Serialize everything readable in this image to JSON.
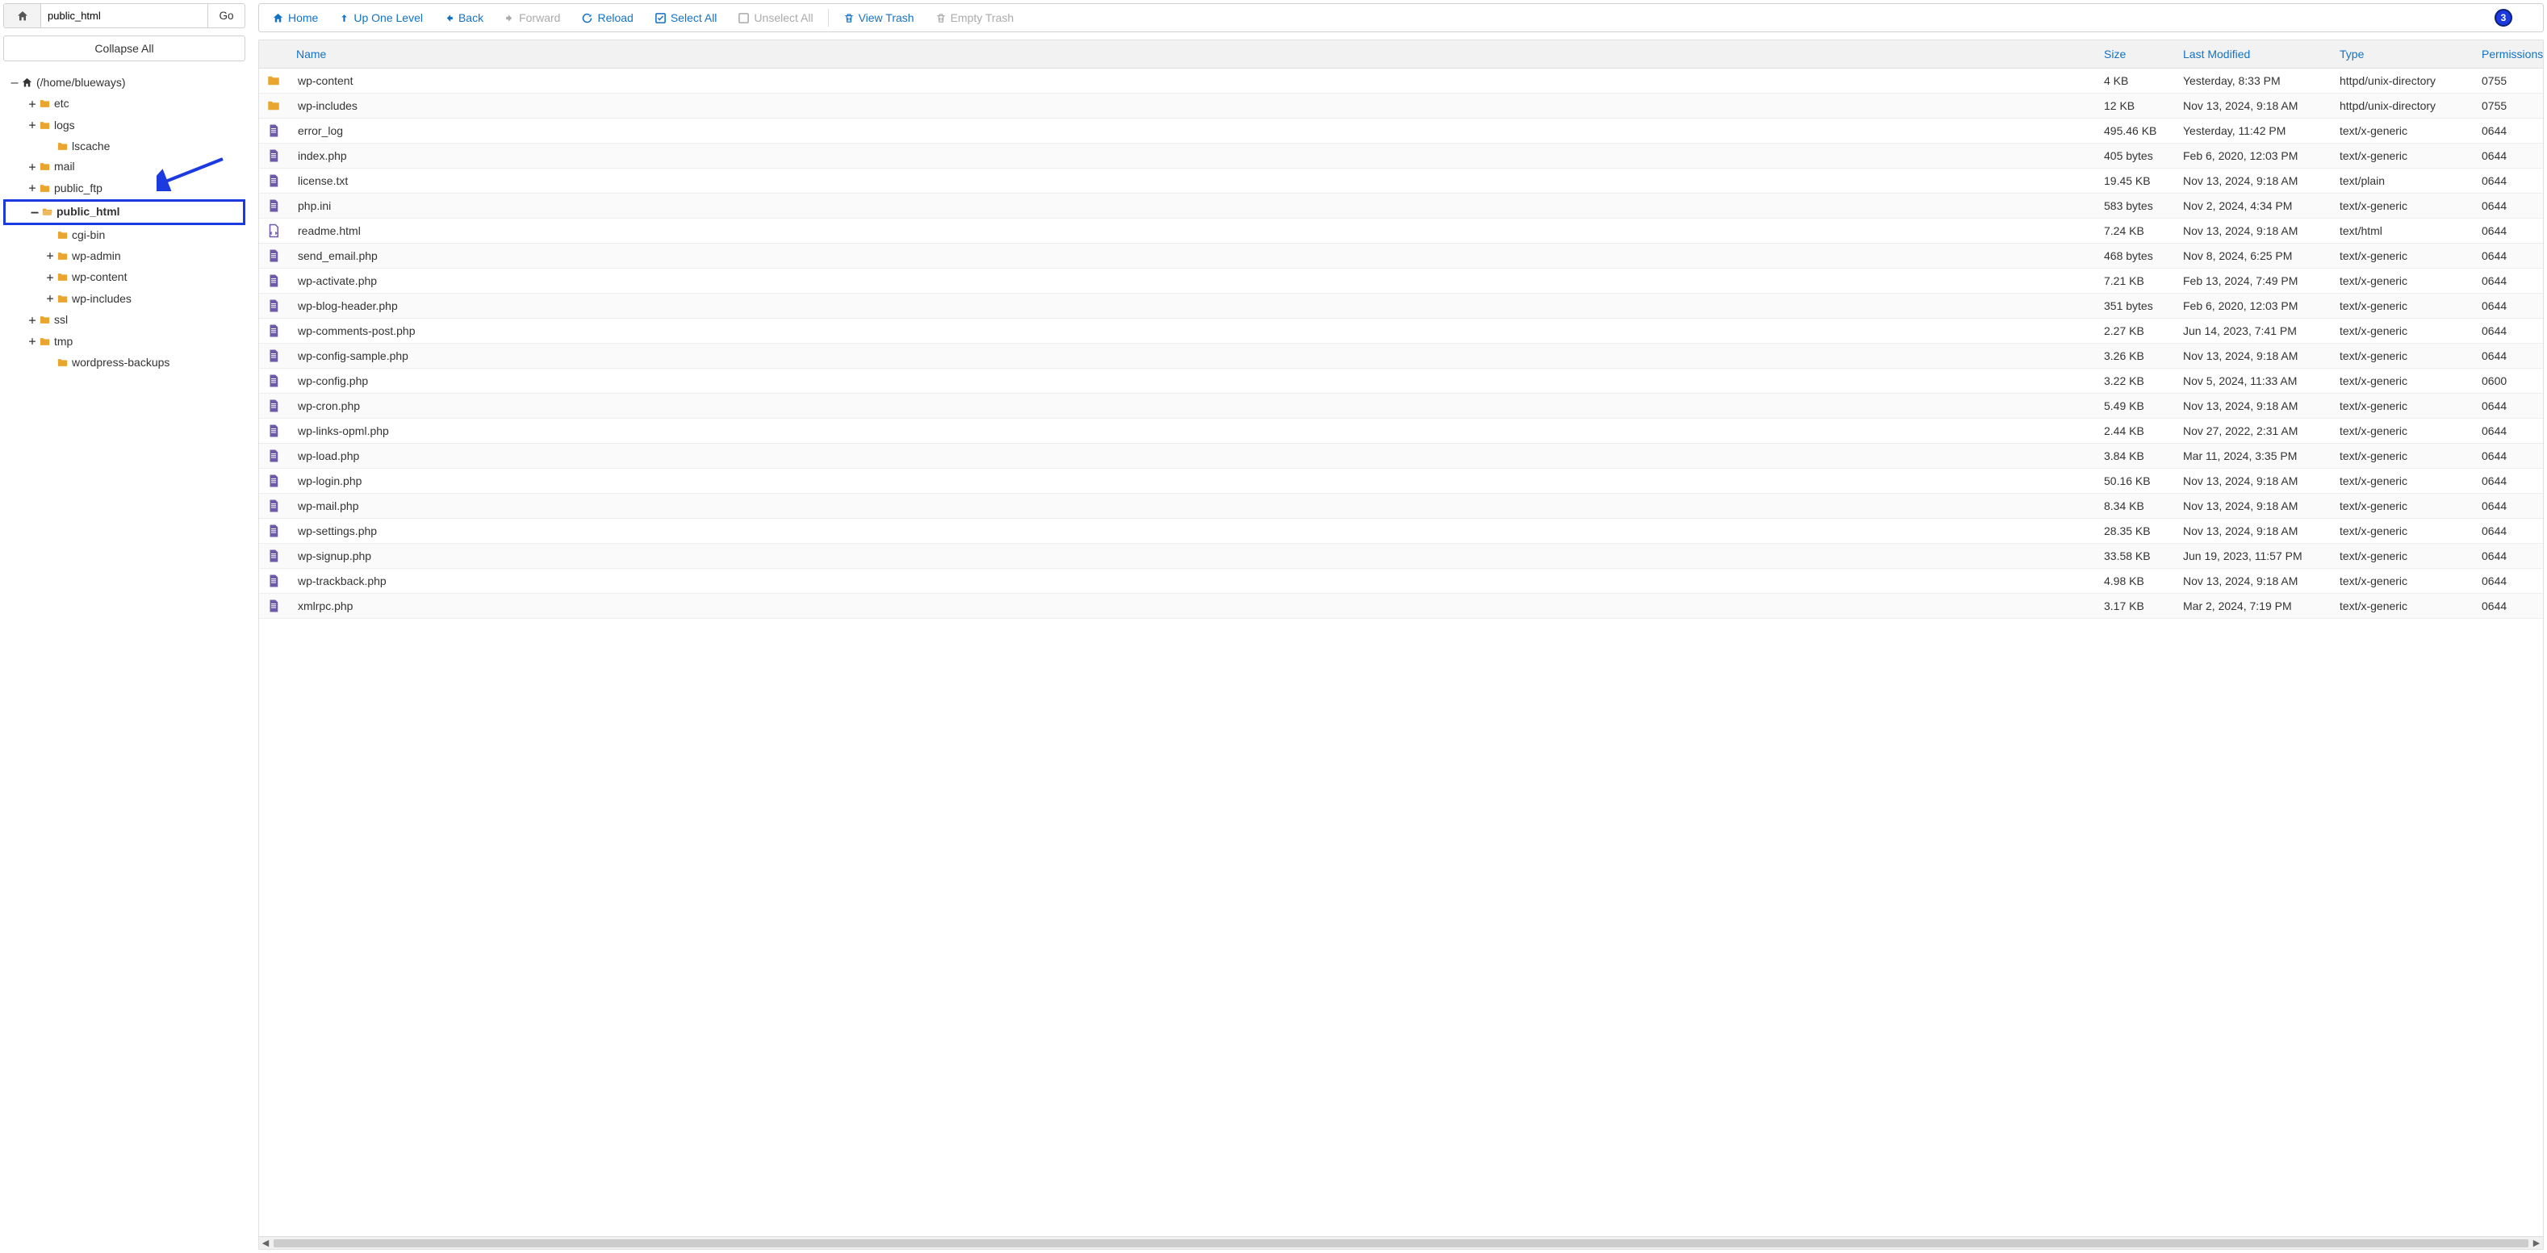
{
  "path_input": "public_html",
  "go_label": "Go",
  "collapse_label": "Collapse All",
  "badge": "3",
  "toolbar": [
    {
      "icon": "home",
      "label": "Home",
      "enabled": true
    },
    {
      "icon": "up",
      "label": "Up One Level",
      "enabled": true
    },
    {
      "icon": "back",
      "label": "Back",
      "enabled": true
    },
    {
      "icon": "forward",
      "label": "Forward",
      "enabled": false
    },
    {
      "icon": "reload",
      "label": "Reload",
      "enabled": true
    },
    {
      "icon": "select",
      "label": "Select All",
      "enabled": true
    },
    {
      "icon": "unselect",
      "label": "Unselect All",
      "enabled": false
    },
    {
      "divider": true
    },
    {
      "icon": "trash",
      "label": "View Trash",
      "enabled": true
    },
    {
      "icon": "trash",
      "label": "Empty Trash",
      "enabled": false
    }
  ],
  "columns": {
    "name": "Name",
    "size": "Size",
    "mod": "Last Modified",
    "type": "Type",
    "perm": "Permissions"
  },
  "tree": [
    {
      "depth": 0,
      "toggle": "–",
      "icon": "folder-open-home",
      "label": "(/home/blueways)"
    },
    {
      "depth": 1,
      "toggle": "+",
      "icon": "folder-closed",
      "label": "etc"
    },
    {
      "depth": 1,
      "toggle": "+",
      "icon": "folder-closed",
      "label": "logs"
    },
    {
      "depth": 2,
      "toggle": "",
      "icon": "folder-closed",
      "label": "lscache"
    },
    {
      "depth": 1,
      "toggle": "+",
      "icon": "folder-closed",
      "label": "mail"
    },
    {
      "depth": 1,
      "toggle": "+",
      "icon": "folder-closed",
      "label": "public_ftp"
    },
    {
      "depth": 1,
      "toggle": "–",
      "icon": "folder-open",
      "label": "public_html",
      "highlight": true
    },
    {
      "depth": 2,
      "toggle": "",
      "icon": "folder-closed",
      "label": "cgi-bin"
    },
    {
      "depth": 2,
      "toggle": "+",
      "icon": "folder-closed",
      "label": "wp-admin"
    },
    {
      "depth": 2,
      "toggle": "+",
      "icon": "folder-closed",
      "label": "wp-content"
    },
    {
      "depth": 2,
      "toggle": "+",
      "icon": "folder-closed",
      "label": "wp-includes"
    },
    {
      "depth": 1,
      "toggle": "+",
      "icon": "folder-closed",
      "label": "ssl"
    },
    {
      "depth": 1,
      "toggle": "+",
      "icon": "folder-closed",
      "label": "tmp"
    },
    {
      "depth": 2,
      "toggle": "",
      "icon": "folder-closed",
      "label": "wordpress-backups"
    }
  ],
  "rows": [
    {
      "icon": "folder",
      "name": "wp-content",
      "size": "4 KB",
      "mod": "Yesterday, 8:33 PM",
      "type": "httpd/unix-directory",
      "perm": "0755"
    },
    {
      "icon": "folder",
      "name": "wp-includes",
      "size": "12 KB",
      "mod": "Nov 13, 2024, 9:18 AM",
      "type": "httpd/unix-directory",
      "perm": "0755"
    },
    {
      "icon": "file",
      "name": "error_log",
      "size": "495.46 KB",
      "mod": "Yesterday, 11:42 PM",
      "type": "text/x-generic",
      "perm": "0644"
    },
    {
      "icon": "file",
      "name": "index.php",
      "size": "405 bytes",
      "mod": "Feb 6, 2020, 12:03 PM",
      "type": "text/x-generic",
      "perm": "0644"
    },
    {
      "icon": "file",
      "name": "license.txt",
      "size": "19.45 KB",
      "mod": "Nov 13, 2024, 9:18 AM",
      "type": "text/plain",
      "perm": "0644"
    },
    {
      "icon": "file",
      "name": "php.ini",
      "size": "583 bytes",
      "mod": "Nov 2, 2024, 4:34 PM",
      "type": "text/x-generic",
      "perm": "0644"
    },
    {
      "icon": "html",
      "name": "readme.html",
      "size": "7.24 KB",
      "mod": "Nov 13, 2024, 9:18 AM",
      "type": "text/html",
      "perm": "0644"
    },
    {
      "icon": "file",
      "name": "send_email.php",
      "size": "468 bytes",
      "mod": "Nov 8, 2024, 6:25 PM",
      "type": "text/x-generic",
      "perm": "0644"
    },
    {
      "icon": "file",
      "name": "wp-activate.php",
      "size": "7.21 KB",
      "mod": "Feb 13, 2024, 7:49 PM",
      "type": "text/x-generic",
      "perm": "0644"
    },
    {
      "icon": "file",
      "name": "wp-blog-header.php",
      "size": "351 bytes",
      "mod": "Feb 6, 2020, 12:03 PM",
      "type": "text/x-generic",
      "perm": "0644"
    },
    {
      "icon": "file",
      "name": "wp-comments-post.php",
      "size": "2.27 KB",
      "mod": "Jun 14, 2023, 7:41 PM",
      "type": "text/x-generic",
      "perm": "0644"
    },
    {
      "icon": "file",
      "name": "wp-config-sample.php",
      "size": "3.26 KB",
      "mod": "Nov 13, 2024, 9:18 AM",
      "type": "text/x-generic",
      "perm": "0644"
    },
    {
      "icon": "file",
      "name": "wp-config.php",
      "size": "3.22 KB",
      "mod": "Nov 5, 2024, 11:33 AM",
      "type": "text/x-generic",
      "perm": "0600"
    },
    {
      "icon": "file",
      "name": "wp-cron.php",
      "size": "5.49 KB",
      "mod": "Nov 13, 2024, 9:18 AM",
      "type": "text/x-generic",
      "perm": "0644"
    },
    {
      "icon": "file",
      "name": "wp-links-opml.php",
      "size": "2.44 KB",
      "mod": "Nov 27, 2022, 2:31 AM",
      "type": "text/x-generic",
      "perm": "0644"
    },
    {
      "icon": "file",
      "name": "wp-load.php",
      "size": "3.84 KB",
      "mod": "Mar 11, 2024, 3:35 PM",
      "type": "text/x-generic",
      "perm": "0644"
    },
    {
      "icon": "file",
      "name": "wp-login.php",
      "size": "50.16 KB",
      "mod": "Nov 13, 2024, 9:18 AM",
      "type": "text/x-generic",
      "perm": "0644"
    },
    {
      "icon": "file",
      "name": "wp-mail.php",
      "size": "8.34 KB",
      "mod": "Nov 13, 2024, 9:18 AM",
      "type": "text/x-generic",
      "perm": "0644"
    },
    {
      "icon": "file",
      "name": "wp-settings.php",
      "size": "28.35 KB",
      "mod": "Nov 13, 2024, 9:18 AM",
      "type": "text/x-generic",
      "perm": "0644"
    },
    {
      "icon": "file",
      "name": "wp-signup.php",
      "size": "33.58 KB",
      "mod": "Jun 19, 2023, 11:57 PM",
      "type": "text/x-generic",
      "perm": "0644"
    },
    {
      "icon": "file",
      "name": "wp-trackback.php",
      "size": "4.98 KB",
      "mod": "Nov 13, 2024, 9:18 AM",
      "type": "text/x-generic",
      "perm": "0644"
    },
    {
      "icon": "file",
      "name": "xmlrpc.php",
      "size": "3.17 KB",
      "mod": "Mar 2, 2024, 7:19 PM",
      "type": "text/x-generic",
      "perm": "0644"
    }
  ]
}
